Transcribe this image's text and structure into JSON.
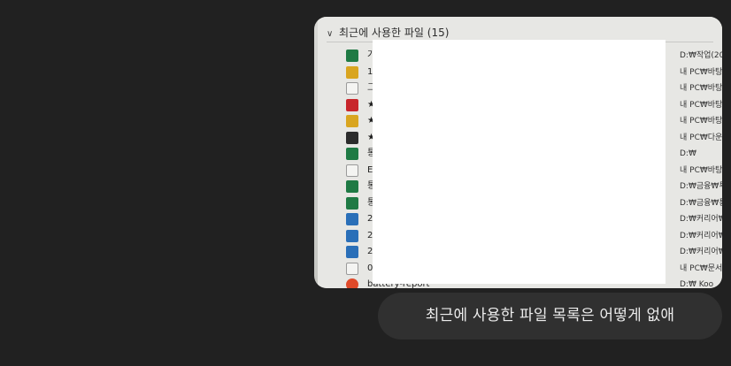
{
  "photo": {
    "section_header": "최근에 사용한 파일 (15)",
    "rows": [
      {
        "icon": "excel-icon",
        "type": "xl",
        "name": "가",
        "path": "D:₩작업(20"
      },
      {
        "icon": "zip-icon",
        "type": "zip",
        "name": "1",
        "path": "내 PC₩바탕"
      },
      {
        "icon": "document-icon",
        "type": "doc",
        "name": "그",
        "path": "내 PC₩바탕"
      },
      {
        "icon": "pdf-icon",
        "type": "pdf",
        "name": "★",
        "path": "내 PC₩바탕"
      },
      {
        "icon": "archive-icon",
        "type": "zip",
        "name": "★",
        "path": "내 PC₩바탕"
      },
      {
        "icon": "egg-icon",
        "type": "egg",
        "name": "★",
        "path": "내 PC₩다운"
      },
      {
        "icon": "excel-icon",
        "type": "xl",
        "name": "통",
        "path": "D:₩"
      },
      {
        "icon": "document-icon",
        "type": "doc",
        "name": "El",
        "path": "내 PC₩바탕"
      },
      {
        "icon": "excel-icon",
        "type": "xl",
        "name": "통",
        "path": "D:₩금융₩투"
      },
      {
        "icon": "excel-icon",
        "type": "xl",
        "name": "통",
        "path": "D:₩금융₩통"
      },
      {
        "icon": "image-icon",
        "type": "img",
        "name": "2",
        "path": "D:₩커리어₩"
      },
      {
        "icon": "image-icon",
        "type": "img",
        "name": "2",
        "path": "D:₩커리어₩"
      },
      {
        "icon": "image-icon",
        "type": "img",
        "name": "2",
        "path": "D:₩커리어₩"
      },
      {
        "icon": "document-icon",
        "type": "doc",
        "name": "0",
        "path": "내 PC₩문서"
      },
      {
        "icon": "report-icon",
        "type": "rpt",
        "name": "battery-report",
        "path": "D:₩ Koo"
      }
    ]
  },
  "message": {
    "text": "최근에 사용한 파일 목록은 어떻게 없애"
  }
}
